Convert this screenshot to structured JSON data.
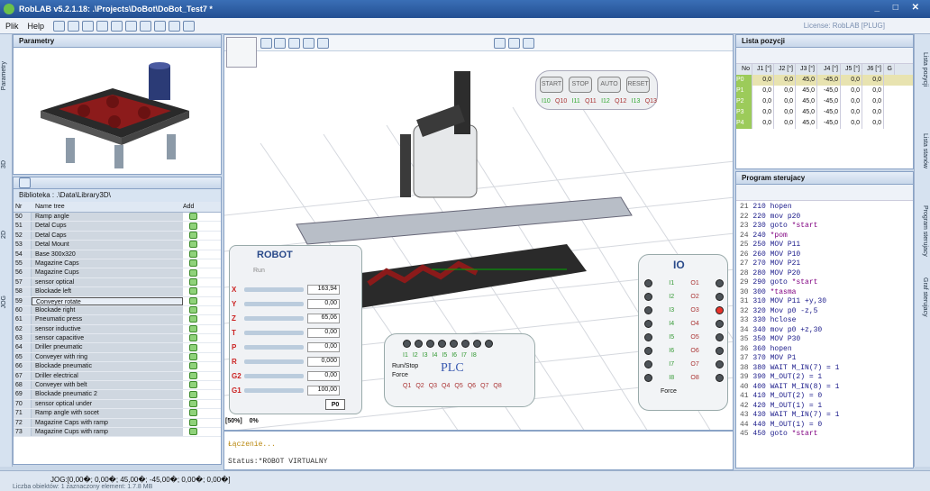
{
  "window": {
    "title": "RobLAB v5.2.1.18:  .\\Projects\\DoBot\\DoBot_Test7 *"
  },
  "menu": [
    "Plik",
    "Help"
  ],
  "license": "License: RobLAB [PLUG]",
  "parametry": {
    "title": "Parametry"
  },
  "left_dock": [
    "Parametry",
    "3D",
    "2D",
    "JOG"
  ],
  "library": {
    "path": "Biblioteka : .\\Data\\Library3D\\",
    "col_nr": "Nr",
    "col_name": "Name tree",
    "col_add": "Add",
    "rows": [
      [
        "50",
        "Ramp angle"
      ],
      [
        "51",
        "Detal Cups"
      ],
      [
        "52",
        "Detal Caps"
      ],
      [
        "53",
        "Detal Mount"
      ],
      [
        "54",
        "Base 300x320"
      ],
      [
        "55",
        "Magazine Caps"
      ],
      [
        "56",
        "Magazine Cups"
      ],
      [
        "57",
        "sensor optical"
      ],
      [
        "58",
        "Blockade  left"
      ],
      [
        "59",
        "Conveyer rotate"
      ],
      [
        "60",
        "Blockade  right"
      ],
      [
        "61",
        "Pneumatic press"
      ],
      [
        "62",
        "sensor inductive"
      ],
      [
        "63",
        "sensor capacitive"
      ],
      [
        "64",
        "Driller pneumatic"
      ],
      [
        "65",
        "Conveyer with ring"
      ],
      [
        "66",
        "Blockade pneumatic"
      ],
      [
        "67",
        "Driller electrical"
      ],
      [
        "68",
        "Conveyer with belt"
      ],
      [
        "69",
        "Blockade pneumatic 2"
      ],
      [
        "70",
        "sensor optical under"
      ],
      [
        "71",
        "Ramp angle with socet"
      ],
      [
        "72",
        "Magazine Caps with ramp"
      ],
      [
        "73",
        "Magazine Cups with ramp"
      ]
    ],
    "selected": "59"
  },
  "control": {
    "start": "START",
    "stop": "STOP",
    "auto": "AUTO",
    "reset": "RESET",
    "inputs": [
      "I10",
      "I11",
      "I12",
      "I13"
    ],
    "outputs": [
      "Q10",
      "Q11",
      "Q12",
      "Q13"
    ]
  },
  "robot": {
    "title": "ROBOT",
    "run": "Run",
    "axes": [
      {
        "name": "X",
        "value": "163,94"
      },
      {
        "name": "Y",
        "value": "0,00"
      },
      {
        "name": "Z",
        "value": "65,06"
      },
      {
        "name": "T",
        "value": "0,00"
      },
      {
        "name": "P",
        "value": "0,00"
      },
      {
        "name": "R",
        "value": "0,000"
      },
      {
        "name": "G2",
        "value": "0,00"
      },
      {
        "name": "G1",
        "value": "100,00"
      }
    ],
    "p0": "P0"
  },
  "plc": {
    "title": "PLC",
    "inputs": [
      "I1",
      "I2",
      "I3",
      "I4",
      "I5",
      "I6",
      "I7",
      "I8"
    ],
    "outputs": [
      "Q1",
      "Q2",
      "Q3",
      "Q4",
      "Q5",
      "Q6",
      "Q7",
      "Q8"
    ],
    "runstop": "Run/Stop",
    "force": "Force"
  },
  "io": {
    "title": "IO",
    "inputs": [
      "I1",
      "I2",
      "I3",
      "I4",
      "I5",
      "I6",
      "I7",
      "I8"
    ],
    "outputs": [
      "O1",
      "O2",
      "O3",
      "O4",
      "O5",
      "O6",
      "O7",
      "O8"
    ],
    "force": "Force",
    "active_output": "O3"
  },
  "zoom": {
    "level": "[50%]",
    "pct": "0%"
  },
  "status": {
    "line1": "Łączenie...",
    "line2": "Status:*ROBOT VIRTUALNY"
  },
  "lista": {
    "title": "Lista pozycji",
    "headers": [
      "No",
      "J1 [°]",
      "J2 [°]",
      "J3 [°]",
      "J4 [°]",
      "J5 [°]",
      "J6 [°]",
      "G"
    ],
    "rows": [
      [
        "P0",
        "0,0",
        "0,0",
        "45,0",
        "-45,0",
        "0,0",
        "0,0"
      ],
      [
        "P1",
        "0,0",
        "0,0",
        "45,0",
        "-45,0",
        "0,0",
        "0,0"
      ],
      [
        "P2",
        "0,0",
        "0,0",
        "45,0",
        "-45,0",
        "0,0",
        "0,0"
      ],
      [
        "P3",
        "0,0",
        "0,0",
        "45,0",
        "-45,0",
        "0,0",
        "0,0"
      ],
      [
        "P4",
        "0,0",
        "0,0",
        "45,0",
        "-45,0",
        "0,0",
        "0,0"
      ]
    ]
  },
  "program": {
    "title": "Program sterujacy",
    "lines": [
      [
        "21",
        "210 hopen",
        ""
      ],
      [
        "22",
        "220 mov p20",
        ""
      ],
      [
        "23",
        "230 goto ",
        "*start"
      ],
      [
        "24",
        "240 ",
        "*pom"
      ],
      [
        "25",
        "250 MOV P11",
        ""
      ],
      [
        "26",
        "260 MOV P10",
        ""
      ],
      [
        "27",
        "270 MOV P21",
        ""
      ],
      [
        "28",
        "280 MOV P20",
        ""
      ],
      [
        "29",
        "290 goto ",
        "*start"
      ],
      [
        "30",
        "300 ",
        "*tasma"
      ],
      [
        "31",
        "310 MOV P11 +y,30",
        ""
      ],
      [
        "32",
        "320 Mov p0 -z,5",
        ""
      ],
      [
        "33",
        "330 hclose",
        ""
      ],
      [
        "34",
        "340 mov p0 +z,30",
        ""
      ],
      [
        "35",
        "350 MOV P30",
        ""
      ],
      [
        "36",
        "360 hopen",
        ""
      ],
      [
        "37",
        "370 MOV P1",
        ""
      ],
      [
        "38",
        "380 WAIT M_IN(7) = 1",
        ""
      ],
      [
        "39",
        "390 M_OUT(2) = 1",
        ""
      ],
      [
        "40",
        "400 WAIT M_IN(8) = 1",
        ""
      ],
      [
        "41",
        "410 M_OUT(2) = 0",
        ""
      ],
      [
        "42",
        "420 M_OUT(1) = 1",
        ""
      ],
      [
        "43",
        "430 WAIT M_IN(7) = 1",
        ""
      ],
      [
        "44",
        "440 M_OUT(1) = 0",
        ""
      ],
      [
        "45",
        "450 goto ",
        "*start"
      ]
    ]
  },
  "right_dock": [
    "Lista pozycji",
    "Lista stanów",
    "Program sterujacy",
    "Graf sterujacy"
  ],
  "bottom": {
    "jog": "JOG:[0,00�; 0,00�; 45,00�; -45,00�; 0,00�; 0,00�]",
    "status": "Liczba obiektów: 1 zaznaczony element: 1.7.8 MB"
  }
}
